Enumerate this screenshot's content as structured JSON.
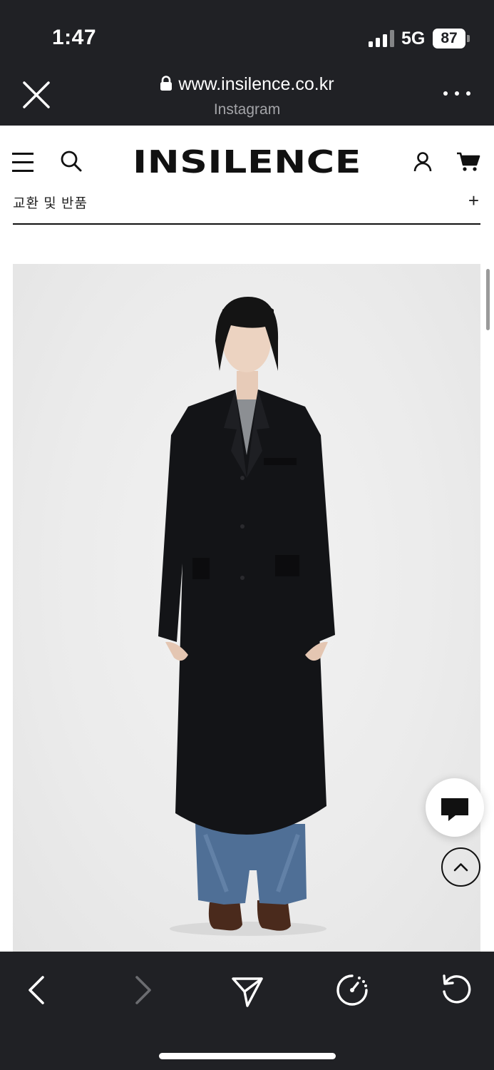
{
  "status_bar": {
    "time": "1:47",
    "network": "5G",
    "battery": "87"
  },
  "browser": {
    "url": "www.insilence.co.kr",
    "source_app": "Instagram",
    "close_icon": "close-icon",
    "more_icon": "more-dots-icon"
  },
  "site": {
    "logo": "INSILENCE",
    "menu_icon": "hamburger-menu-icon",
    "search_icon": "search-icon",
    "account_icon": "account-icon",
    "cart_icon": "cart-icon"
  },
  "accordion": {
    "label": "교환 및 반품",
    "toggle": "+"
  },
  "product": {
    "image_description_icon": "product-photo"
  },
  "floating": {
    "chat_icon": "chat-bubble-icon",
    "top_icon": "chevron-up-icon"
  },
  "toolbar": {
    "items": [
      "back-arrow-icon",
      "forward-arrow-icon",
      "share-send-icon",
      "speed-dial-icon",
      "reload-icon"
    ]
  },
  "colors": {
    "chrome_bg": "#202125",
    "page_bg": "#ffffff",
    "text_dark": "#111111",
    "muted": "#a3a4a8"
  }
}
